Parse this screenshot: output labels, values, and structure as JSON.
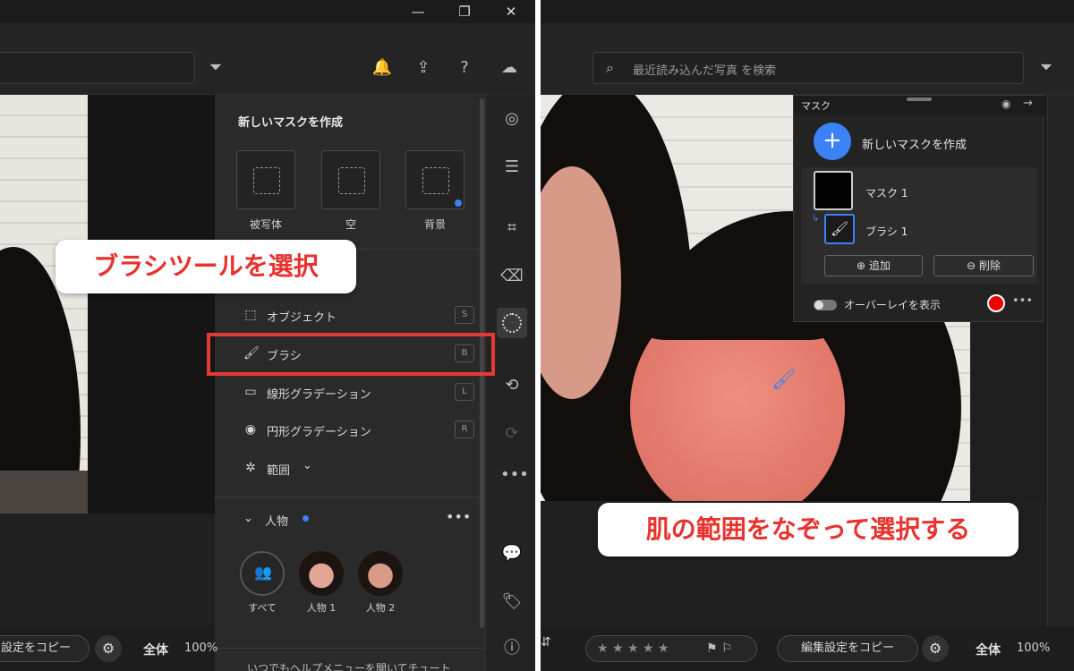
{
  "left": {
    "window_controls": {
      "minimize": "—",
      "maximize": "❐",
      "close": "✕"
    },
    "mask_panel": {
      "title": "新しいマスクを作成",
      "quick_buttons": [
        {
          "label": "被写体"
        },
        {
          "label": "空"
        },
        {
          "label": "背景"
        }
      ],
      "tools": [
        {
          "label": "オブジェクト",
          "key": "S"
        },
        {
          "label": "ブラシ",
          "key": "B"
        },
        {
          "label": "線形グラデーション",
          "key": "L"
        },
        {
          "label": "円形グラデーション",
          "key": "R"
        },
        {
          "label": "範囲",
          "key": ""
        }
      ],
      "persons": {
        "title": "人物",
        "items": [
          {
            "label": "すべて"
          },
          {
            "label": "人物 1"
          },
          {
            "label": "人物 2"
          }
        ]
      },
      "help_text": "いつでもヘルプメニューを開いてチュート"
    },
    "bottom": {
      "copy_settings": "設定をコピー",
      "view": "全体",
      "zoom": "100%"
    },
    "callout": "ブラシツールを選択"
  },
  "right": {
    "search": {
      "placeholder": "最近読み込んだ写真 を検索"
    },
    "mask_popup": {
      "title": "マスク",
      "create_label": "新しいマスクを作成",
      "mask_name": "マスク 1",
      "brush_name": "ブラシ 1",
      "add_label": "追加",
      "delete_label": "削除",
      "overlay_label": "オーバーレイを表示",
      "overlay_color": "#ee0000"
    },
    "bottom": {
      "stars": "★ ★ ★ ★ ★",
      "copy_settings": "編集設定をコピー",
      "view": "全体",
      "zoom": "100%"
    },
    "callout": "肌の範囲をなぞって選択する"
  },
  "colors": {
    "accent": "#3b82f6",
    "highlight": "#e53935",
    "callout_text": "#e8322d"
  }
}
